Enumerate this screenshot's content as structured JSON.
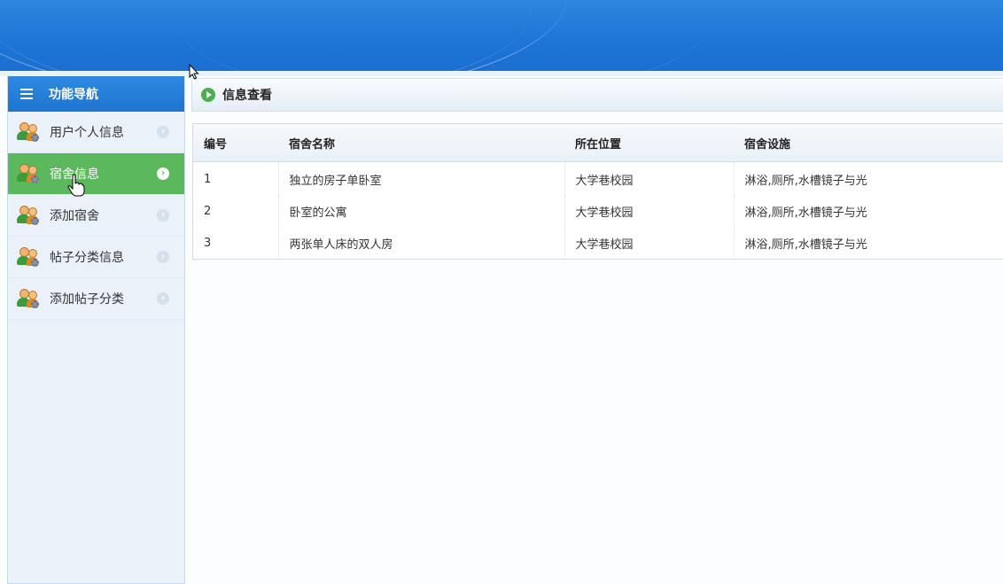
{
  "sidebar": {
    "title": "功能导航",
    "items": [
      {
        "label": "用户个人信息",
        "active": false
      },
      {
        "label": "宿舍信息",
        "active": true
      },
      {
        "label": "添加宿舍",
        "active": false
      },
      {
        "label": "帖子分类信息",
        "active": false
      },
      {
        "label": "添加帖子分类",
        "active": false
      }
    ]
  },
  "main": {
    "title": "信息查看",
    "table": {
      "headers": [
        "编号",
        "宿舍名称",
        "所在位置",
        "宿舍设施"
      ],
      "rows": [
        [
          "1",
          "独立的房子单卧室",
          "大学巷校园",
          "淋浴,厕所,水槽镜子与光"
        ],
        [
          "2",
          "卧室的公寓",
          "大学巷校园",
          "淋浴,厕所,水槽镜子与光"
        ],
        [
          "3",
          "两张单人床的双人房",
          "大学巷校园",
          "淋浴,厕所,水槽镜子与光"
        ]
      ]
    }
  },
  "colors": {
    "banner": "#1f76d6",
    "active": "#5cb85c",
    "nav_header": "#2a82dc"
  },
  "icons": {
    "nav_header": "list-icon",
    "nav_item": "users-gear-icon",
    "nav_arrow": "chevron-right-icon",
    "panel": "play-circle-icon"
  }
}
